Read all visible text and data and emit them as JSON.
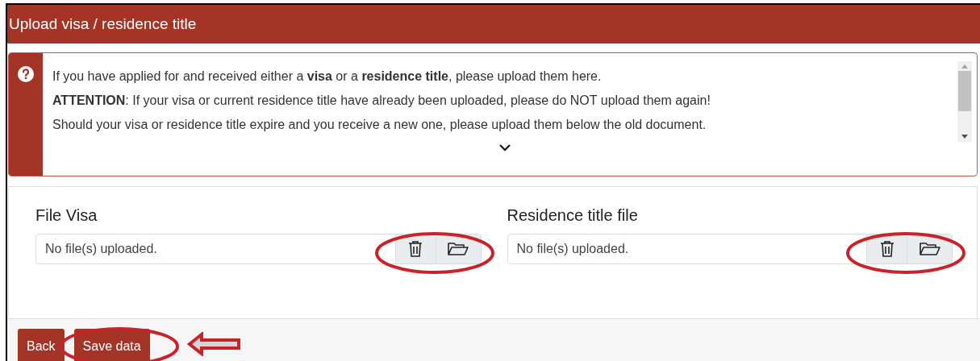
{
  "header": {
    "title": "Upload visa / residence title"
  },
  "info": {
    "lines": [
      "If you have applied for and received either a **visa** or a **residence title**, please upload them here.",
      "**ATTENTION**: If your visa or current residence title have already been uploaded, please do NOT upload them again!",
      "Should your visa or residence title expire and you receive a new one, please upload them below the old document."
    ]
  },
  "fields": [
    {
      "label": "File Visa",
      "value": "No file(s) uploaded."
    },
    {
      "label": "Residence title file",
      "value": "No file(s) uploaded."
    }
  ],
  "buttons": [
    "Back",
    "Save data"
  ]
}
